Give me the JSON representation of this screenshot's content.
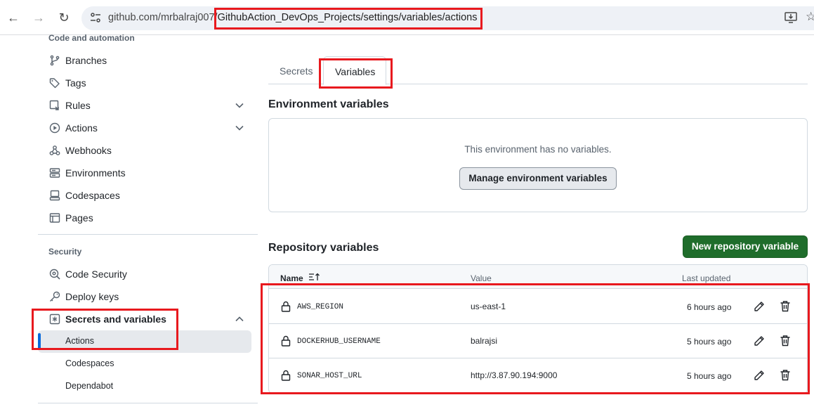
{
  "browser": {
    "url_host": "github.com/mrbalraj007/",
    "url_path": "GithubAction_DevOps_Projects/settings/variables/actions"
  },
  "sidebar": {
    "section_code_automation": "Code and automation",
    "items": [
      {
        "label": "Branches",
        "icon": "git-branch-icon"
      },
      {
        "label": "Tags",
        "icon": "tag-icon"
      },
      {
        "label": "Rules",
        "icon": "rules-icon",
        "expandable": true
      },
      {
        "label": "Actions",
        "icon": "play-icon",
        "expandable": true
      },
      {
        "label": "Webhooks",
        "icon": "webhook-icon"
      },
      {
        "label": "Environments",
        "icon": "server-icon"
      },
      {
        "label": "Codespaces",
        "icon": "codespaces-icon"
      },
      {
        "label": "Pages",
        "icon": "browser-icon"
      }
    ],
    "section_security": "Security",
    "security_items": [
      {
        "label": "Code Security",
        "icon": "codescan-icon"
      },
      {
        "label": "Deploy keys",
        "icon": "key-icon"
      },
      {
        "label": "Secrets and variables",
        "icon": "asterisk-icon",
        "expanded": true
      }
    ],
    "sub_items": [
      {
        "label": "Actions",
        "active": true
      },
      {
        "label": "Codespaces"
      },
      {
        "label": "Dependabot"
      }
    ]
  },
  "tabs": {
    "secrets": "Secrets",
    "variables": "Variables"
  },
  "environment": {
    "title": "Environment variables",
    "empty_text": "This environment has no variables.",
    "manage_button": "Manage environment variables"
  },
  "repository": {
    "title": "Repository variables",
    "new_button": "New repository variable",
    "columns": {
      "name": "Name",
      "value": "Value",
      "updated": "Last updated"
    },
    "rows": [
      {
        "name": "AWS_REGION",
        "value": "us-east-1",
        "updated": "6 hours ago"
      },
      {
        "name": "DOCKERHUB_USERNAME",
        "value": "balrajsi",
        "updated": "5 hours ago"
      },
      {
        "name": "SONAR_HOST_URL",
        "value": "http://3.87.90.194:9000",
        "updated": "5 hours ago"
      }
    ]
  },
  "colors": {
    "accent": "#0969da",
    "primary_button": "#1f6d2b",
    "highlight_box": "#e8191e"
  }
}
